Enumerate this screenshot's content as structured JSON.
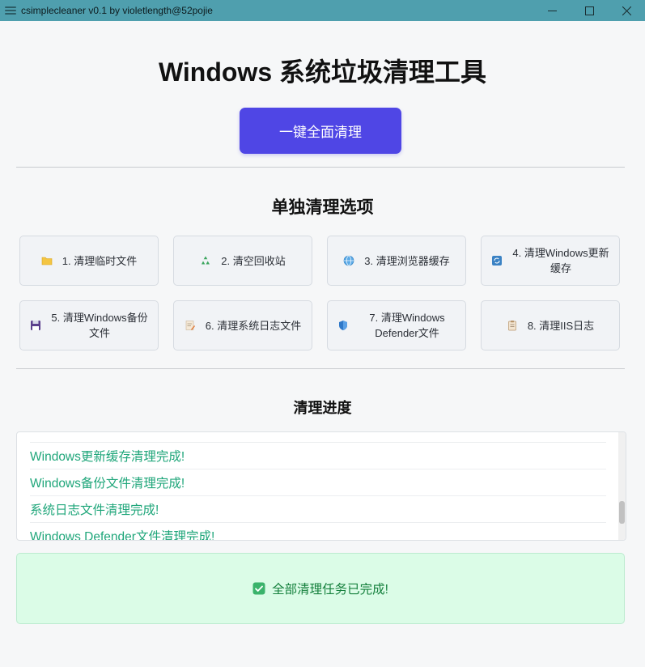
{
  "window": {
    "title": "csimplecleaner v0.1 by violetlength@52pojie",
    "controls": [
      "minimize-icon",
      "maximize-icon",
      "close-icon"
    ]
  },
  "header": {
    "title": "Windows 系统垃圾清理工具",
    "clean_all_label": "一键全面清理"
  },
  "options": {
    "title": "单独清理选项",
    "items": [
      {
        "label": "1. 清理临时文件",
        "icon": "folder-icon"
      },
      {
        "label": "2. 清空回收站",
        "icon": "recycle-icon"
      },
      {
        "label": "3. 清理浏览器缓存",
        "icon": "globe-icon"
      },
      {
        "label": "4. 清理Windows更新缓存",
        "icon": "refresh-icon"
      },
      {
        "label": "5. 清理Windows备份文件",
        "icon": "floppy-disk-icon"
      },
      {
        "label": "6. 清理系统日志文件",
        "icon": "memo-icon"
      },
      {
        "label": "7. 清理Windows Defender文件",
        "icon": "shield-icon"
      },
      {
        "label": "8. 清理IIS日志",
        "icon": "clipboard-icon"
      }
    ]
  },
  "progress": {
    "title": "清理进度",
    "log": [
      "Windows更新缓存清理完成!",
      "Windows备份文件清理完成!",
      "系统日志文件清理完成!",
      "Windows Defender文件清理完成!"
    ]
  },
  "status": {
    "icon": "check-mark-icon",
    "text": "全部清理任务已完成!"
  },
  "colors": {
    "titlebar": "#4f9fae",
    "primary_button": "#4f46e5",
    "log_text": "#1fa67a",
    "success_bg": "#dbfce7",
    "success_text": "#15803d"
  }
}
